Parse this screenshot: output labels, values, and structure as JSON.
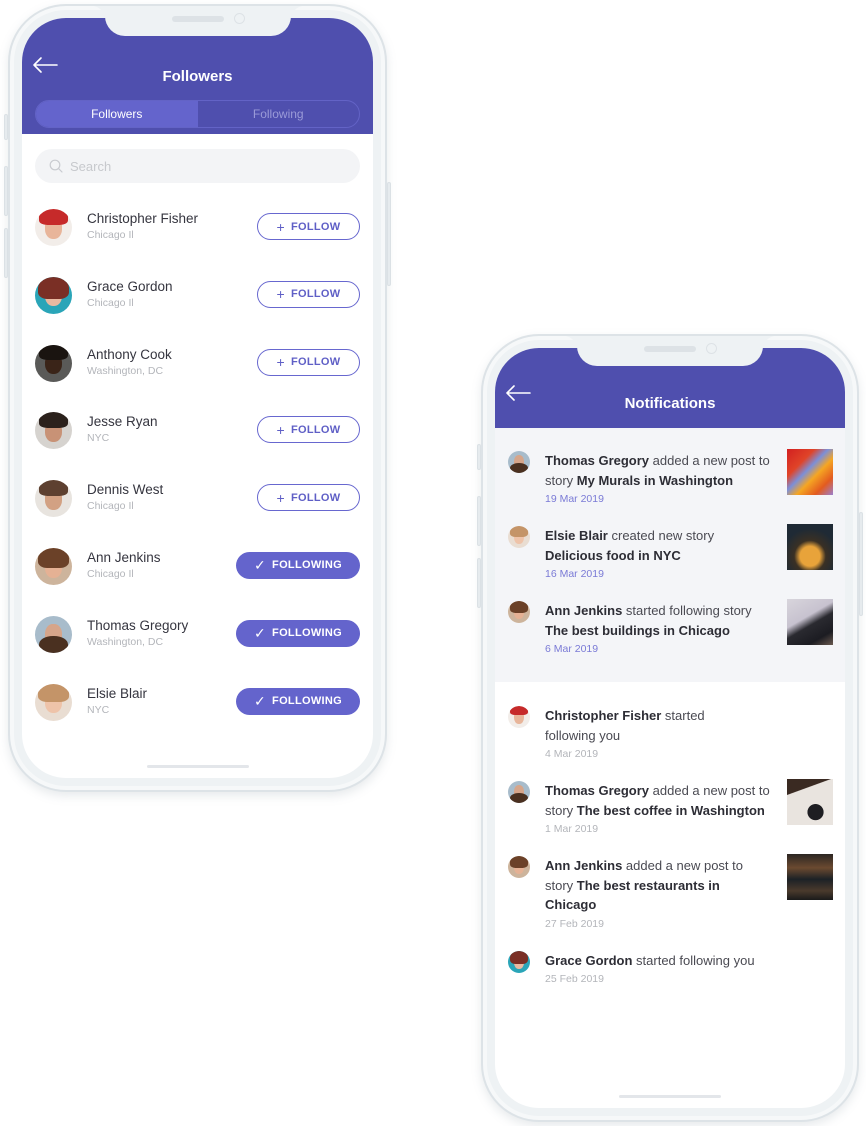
{
  "colors": {
    "header": "#4f4fae",
    "accent": "#6464cc",
    "unread_bg": "#f4f5f8",
    "unread_date": "#7a7ad6"
  },
  "followers_screen": {
    "title": "Followers",
    "back_icon": "arrow-left-icon",
    "tabs": [
      {
        "label": "Followers",
        "active": true
      },
      {
        "label": "Following",
        "active": false
      }
    ],
    "search": {
      "placeholder": "Search",
      "value": "",
      "icon": "search-icon"
    },
    "users": [
      {
        "name": "Christopher Fisher",
        "location": "Chicago Il",
        "button": "FOLLOW",
        "button_icon": "+",
        "following": false
      },
      {
        "name": "Grace Gordon",
        "location": "Chicago Il",
        "button": "FOLLOW",
        "button_icon": "+",
        "following": false
      },
      {
        "name": "Anthony Cook",
        "location": "Washington, DC",
        "button": "FOLLOW",
        "button_icon": "+",
        "following": false
      },
      {
        "name": "Jesse Ryan",
        "location": "NYC",
        "button": "FOLLOW",
        "button_icon": "+",
        "following": false
      },
      {
        "name": "Dennis West",
        "location": "Chicago Il",
        "button": "FOLLOW",
        "button_icon": "+",
        "following": false
      },
      {
        "name": "Ann Jenkins",
        "location": "Chicago Il",
        "button": "FOLLOWING",
        "button_icon": "✓",
        "following": true
      },
      {
        "name": "Thomas Gregory",
        "location": "Washington, DC",
        "button": "FOLLOWING",
        "button_icon": "✓",
        "following": true
      },
      {
        "name": "Elsie Blair",
        "location": "NYC",
        "button": "FOLLOWING",
        "button_icon": "✓",
        "following": true
      }
    ]
  },
  "notifications_screen": {
    "title": "Notifications",
    "back_icon": "arrow-left-icon",
    "items": [
      {
        "actor": "Thomas Gregory",
        "action": " added a new post to story ",
        "target": "My Murals in Washington",
        "date": "19 Mar 2019",
        "unread": true,
        "thumbnail": "murals-thumbnail"
      },
      {
        "actor": "Elsie Blair",
        "action": " created new story ",
        "target": "Delicious food in NYC",
        "date": "16 Mar 2019",
        "unread": true,
        "thumbnail": "food-thumbnail"
      },
      {
        "actor": "Ann Jenkins",
        "action": " started following story ",
        "target": "The best buildings in Chicago",
        "date": "6 Mar 2019",
        "unread": true,
        "thumbnail": "buildings-thumbnail"
      },
      {
        "actor": "Christopher Fisher",
        "action": " started following you",
        "target": "",
        "date": "4 Mar 2019",
        "unread": false,
        "thumbnail": ""
      },
      {
        "actor": "Thomas Gregory",
        "action": " added a new post to story ",
        "target": "The best coffee in Washington",
        "date": "1 Mar 2019",
        "unread": false,
        "thumbnail": "coffee-thumbnail"
      },
      {
        "actor": "Ann Jenkins",
        "action": " added a new post to story ",
        "target": "The best restaurants in Chicago",
        "date": "27 Feb 2019",
        "unread": false,
        "thumbnail": "restaurant-thumbnail"
      },
      {
        "actor": "Grace Gordon",
        "action": " started following you",
        "target": "",
        "date": "25 Feb 2019",
        "unread": false,
        "thumbnail": ""
      }
    ]
  }
}
